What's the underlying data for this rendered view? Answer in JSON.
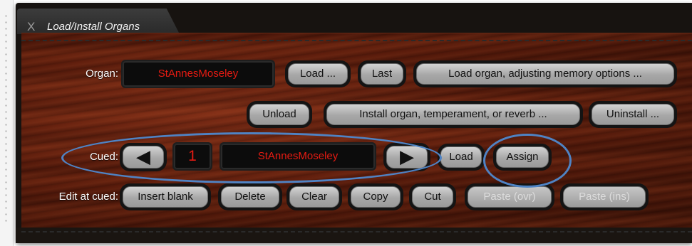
{
  "window": {
    "title": "Load/Install Organs",
    "close_glyph": "X"
  },
  "organ_row": {
    "label": "Organ:",
    "current_organ": "StAnnesMoseley",
    "load_btn": "Load ...",
    "last_btn": "Last",
    "load_adjust_btn": "Load organ, adjusting memory options ..."
  },
  "install_row": {
    "unload_btn": "Unload",
    "install_btn": "Install organ, temperament, or reverb ...",
    "uninstall_btn": "Uninstall ..."
  },
  "cued_row": {
    "label": "Cued:",
    "prev_glyph": "◀",
    "cue_number": "1",
    "cued_organ": "StAnnesMoseley",
    "next_glyph": "▶",
    "load_btn": "Load",
    "assign_btn": "Assign"
  },
  "edit_row": {
    "label": "Edit at cued:",
    "insert_blank_btn": "Insert blank",
    "delete_btn": "Delete",
    "clear_btn": "Clear",
    "copy_btn": "Copy",
    "cut_btn": "Cut",
    "paste_ovr_btn": "Paste (ovr)",
    "paste_ins_btn": "Paste (ins)"
  },
  "colors": {
    "display_text": "#e61b12",
    "annotation_ring": "#4f83c4",
    "wood": "#5a1b0b"
  }
}
